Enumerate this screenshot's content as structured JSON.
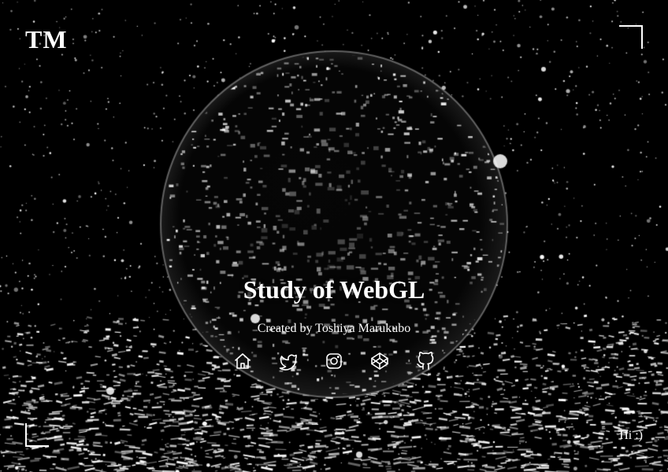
{
  "header": {
    "logo": "TM"
  },
  "main": {
    "title": "Study of WebGL",
    "credit": "Created by Toshiya Marukubo",
    "social_links": [
      {
        "icon": "home-icon"
      },
      {
        "icon": "twitter-icon"
      },
      {
        "icon": "instagram-icon"
      },
      {
        "icon": "codepen-icon"
      },
      {
        "icon": "github-icon"
      }
    ]
  },
  "footer": {
    "greeting": "Hi :)"
  },
  "colors": {
    "background": "#000000",
    "foreground": "#ffffff"
  }
}
